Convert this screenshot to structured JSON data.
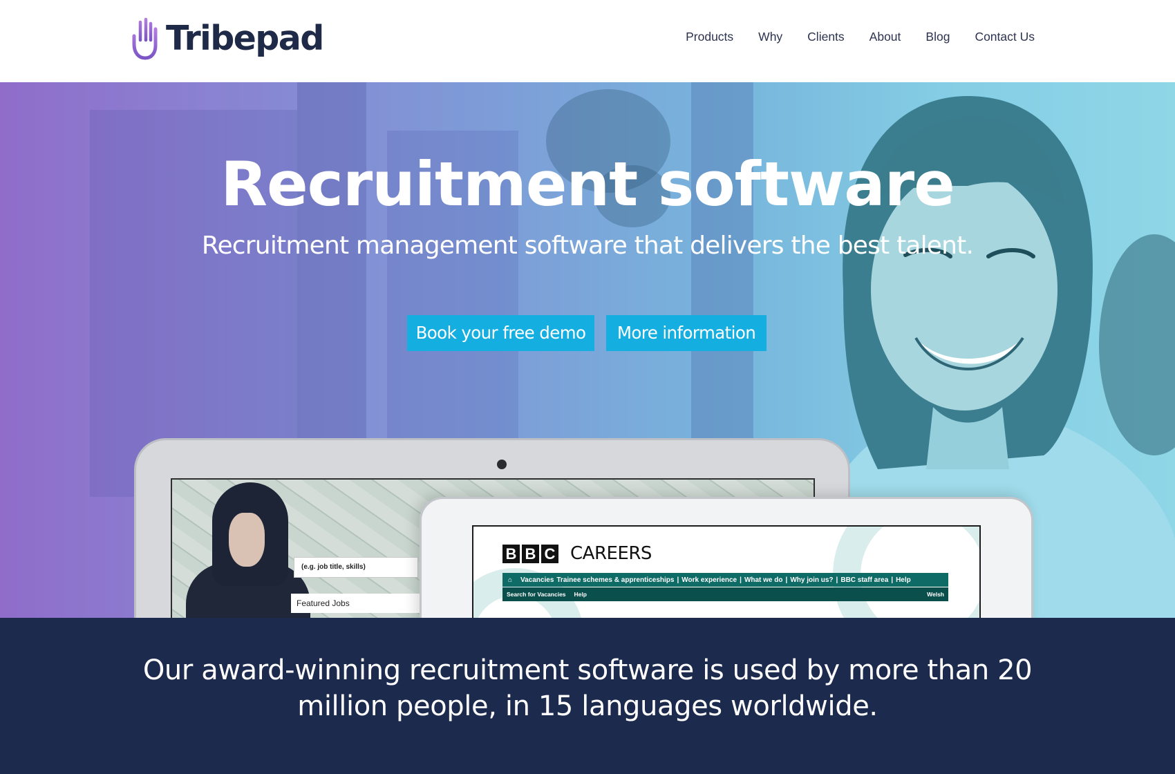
{
  "brand": {
    "name": "Tribepad",
    "logo_icon": "hand-icon",
    "logo_color": "#8e62c9",
    "text_color": "#1f2a48"
  },
  "nav": {
    "items": [
      "Products",
      "Why",
      "Clients",
      "About",
      "Blog",
      "Contact Us"
    ]
  },
  "hero": {
    "title": "Recruitment software",
    "subtitle": "Recruitment management software that delivers the best talent.",
    "buttons": {
      "demo": "Book your free demo",
      "info": "More information"
    },
    "button_color": "#14aee0"
  },
  "devices": {
    "laptop": {
      "search_placeholder": "(e.g. job title, skills)",
      "featured": "Featured Jobs"
    },
    "tablet": {
      "logo_letters": [
        "B",
        "B",
        "C"
      ],
      "careers": "CAREERS",
      "nav": [
        "Vacancies",
        "Trainee schemes & apprenticeships",
        "|",
        "Work experience",
        "|",
        "What we do",
        "|",
        "Why join us?",
        "|",
        "BBC staff area",
        "|",
        "Help"
      ],
      "subnav": {
        "search": "Search for Vacancies",
        "help": "Help",
        "welsh": "Welsh"
      }
    }
  },
  "band": {
    "text": "Our award-winning recruitment software is used by more than 20 million people, in 15 languages worldwide.",
    "color": "#1c2a4d"
  }
}
